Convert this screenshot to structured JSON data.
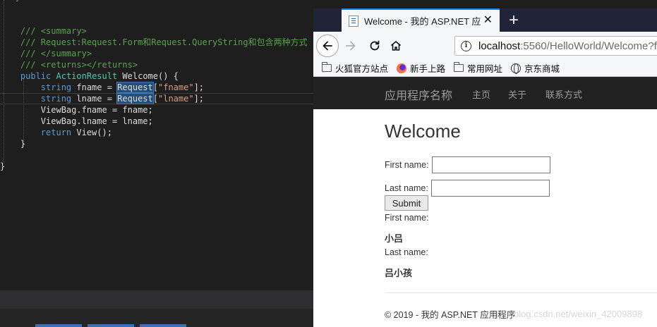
{
  "editor": {
    "lines": [
      {
        "parts": [
          {
            "c": "c-comment",
            "t": "   }"
          }
        ]
      },
      {
        "parts": [
          {
            "c": "c-plain",
            "t": ""
          }
        ]
      },
      {
        "parts": [
          {
            "c": "c-plain",
            "t": ""
          }
        ]
      },
      {
        "parts": [
          {
            "c": "c-plain",
            "t": "    "
          },
          {
            "c": "c-comment",
            "t": "/// <summary>"
          }
        ]
      },
      {
        "parts": [
          {
            "c": "c-plain",
            "t": "    "
          },
          {
            "c": "c-comment",
            "t": "/// Request:Request.Form和Request.QueryString和包含两种方式"
          }
        ]
      },
      {
        "parts": [
          {
            "c": "c-plain",
            "t": "    "
          },
          {
            "c": "c-comment",
            "t": "/// </summary>"
          }
        ]
      },
      {
        "parts": [
          {
            "c": "c-plain",
            "t": "    "
          },
          {
            "c": "c-comment",
            "t": "/// <returns></returns>"
          }
        ]
      },
      {
        "parts": [
          {
            "c": "c-plain",
            "t": "    "
          },
          {
            "c": "c-kw",
            "t": "public"
          },
          {
            "c": "c-plain",
            "t": " "
          },
          {
            "c": "c-type",
            "t": "ActionResult"
          },
          {
            "c": "c-plain",
            "t": " Welcome() {"
          }
        ]
      },
      {
        "parts": [
          {
            "c": "c-plain",
            "t": "        "
          },
          {
            "c": "c-kw",
            "t": "string"
          },
          {
            "c": "c-plain",
            "t": " fname = "
          },
          {
            "c": "c-plain c-hl",
            "t": "Request"
          },
          {
            "c": "c-plain",
            "t": "["
          },
          {
            "c": "c-str",
            "t": "\"fname\""
          },
          {
            "c": "c-plain",
            "t": "];"
          }
        ]
      },
      {
        "cur": true,
        "parts": [
          {
            "c": "c-plain",
            "t": "        "
          },
          {
            "c": "c-kw",
            "t": "string"
          },
          {
            "c": "c-plain",
            "t": " lname = "
          },
          {
            "c": "c-plain c-hl",
            "t": "Request"
          },
          {
            "c": "c-plain",
            "t": "["
          },
          {
            "c": "c-str",
            "t": "\"lname\""
          },
          {
            "c": "c-plain",
            "t": "];"
          }
        ]
      },
      {
        "parts": [
          {
            "c": "c-plain",
            "t": "        ViewBag.fname = fname;"
          }
        ]
      },
      {
        "parts": [
          {
            "c": "c-plain",
            "t": "        ViewBag.lname = lname;"
          }
        ]
      },
      {
        "parts": [
          {
            "c": "c-plain",
            "t": "        "
          },
          {
            "c": "c-kw",
            "t": "return"
          },
          {
            "c": "c-plain",
            "t": " View();"
          }
        ]
      },
      {
        "parts": [
          {
            "c": "c-plain",
            "t": "    }"
          }
        ]
      },
      {
        "parts": [
          {
            "c": "c-plain",
            "t": ""
          }
        ]
      },
      {
        "parts": [
          {
            "c": "c-plain",
            "t": "}"
          }
        ]
      }
    ]
  },
  "browser": {
    "tab_title": "Welcome - 我的 ASP.NET 应用",
    "tab_close": "✕",
    "new_tab": "+",
    "url_host": "localhost",
    "url_path": ":5560/HelloWorld/Welcome?f",
    "info_glyph": "i",
    "bookmarks": [
      {
        "label": "火狐官方站点",
        "icon": "folder"
      },
      {
        "label": "新手上路",
        "icon": "firefox"
      },
      {
        "label": "常用网址",
        "icon": "folder"
      },
      {
        "label": "京东商城",
        "icon": "globe"
      }
    ]
  },
  "site": {
    "brand": "应用程序名称",
    "nav": [
      "主页",
      "关于",
      "联系方式"
    ],
    "title": "Welcome",
    "first_label": "First name:",
    "last_label": "Last name:",
    "first_value": "",
    "last_value": "",
    "submit": "Submit",
    "out_first_label": "First name:",
    "out_first_value": "小吕",
    "out_last_label": "Last name:",
    "out_last_value": "吕小孩",
    "footer": "© 2019 - 我的 ASP.NET 应用程序",
    "watermark": "https://blog.csdn.net/weixin_42009898"
  }
}
